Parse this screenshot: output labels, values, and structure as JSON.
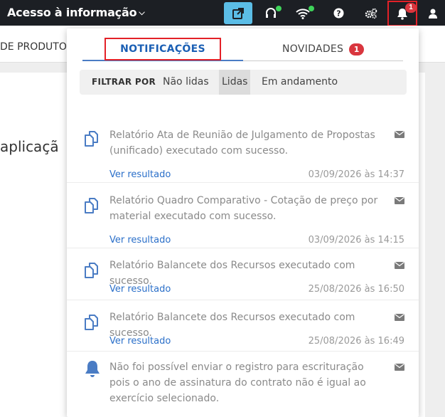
{
  "topbar": {
    "title": "Acesso à informação",
    "icons": [
      "external-link-icon",
      "headset-icon",
      "wifi-icon",
      "help-icon",
      "gears-icon",
      "bell-icon",
      "user-icon"
    ],
    "bell_badge": "1",
    "accent_color": "#5bbde6",
    "status_color": "#3ed35a"
  },
  "background": {
    "subnav_text": "DE PRODUTOS",
    "main_text": "aplicaçã"
  },
  "panel": {
    "tabs": {
      "notifications": "NOTIFICAÇÕES",
      "news": "NOVIDADES",
      "news_badge": "1"
    },
    "filter": {
      "label": "FILTRAR POR",
      "options": [
        "Não lidas",
        "Lidas",
        "Em andamento"
      ],
      "selected": "Lidas"
    },
    "notifications": [
      {
        "icon": "copy-icon",
        "message": "Relatório Ata de Reunião de Julgamento de Propostas (unificado) executado com sucesso.",
        "link": "Ver resultado",
        "date": "03/09/2026 às 14:37"
      },
      {
        "icon": "copy-icon",
        "message": "Relatório Quadro Comparativo - Cotação de preço por material executado com sucesso.",
        "link": "Ver resultado",
        "date": "03/09/2026 às 14:15"
      },
      {
        "icon": "copy-icon",
        "message": "Relatório Balancete dos Recursos executado com sucesso.",
        "link": "Ver resultado",
        "date": "25/08/2026 às 16:50"
      },
      {
        "icon": "copy-icon",
        "message": "Relatório Balancete dos Recursos executado com sucesso.",
        "link": "Ver resultado",
        "date": "25/08/2026 às 16:49"
      },
      {
        "icon": "bell-icon",
        "message": "Não foi possível enviar o registro para escrituração pois o ano de assinatura do contrato não é igual ao exercício selecionado.",
        "link": "",
        "date": ""
      }
    ]
  }
}
